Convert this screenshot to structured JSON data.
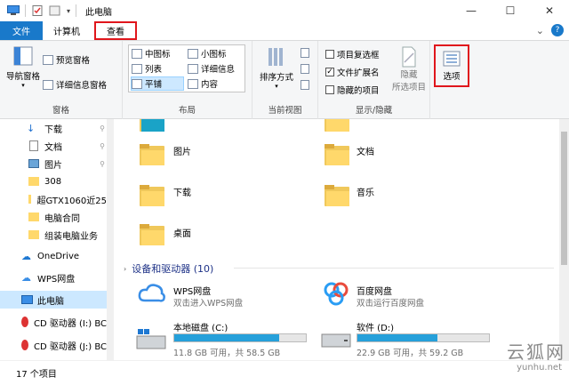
{
  "window": {
    "title": "此电脑",
    "controls": {
      "minimize": "—",
      "maximize": "☐",
      "close": "✕"
    }
  },
  "tabs": [
    {
      "label": "文件"
    },
    {
      "label": "计算机"
    },
    {
      "label": "查看"
    }
  ],
  "tabbar_icons": {
    "chevron": "⌄",
    "help": "?"
  },
  "ribbon": {
    "panes": {
      "label": "窗格",
      "nav_pane": "导航窗格",
      "preview_pane": "预览窗格",
      "details_pane": "详细信息窗格"
    },
    "layout": {
      "label": "布局",
      "items": [
        "中图标",
        "小图标",
        "列表",
        "详细信息",
        "平铺",
        "内容"
      ],
      "selected": "平铺"
    },
    "current_view": {
      "label": "当前视图",
      "sort_by": "排序方式"
    },
    "show_hide": {
      "label": "显示/隐藏",
      "item_checkboxes": "项目复选框",
      "file_extensions": "文件扩展名",
      "hidden_items": "隐藏的项目",
      "hide_selected_1": "隐藏",
      "hide_selected_2": "所选项目",
      "checked": {
        "item_checkboxes": false,
        "file_extensions": true,
        "hidden_items": false
      }
    },
    "options": {
      "label": "选项"
    }
  },
  "nav": {
    "items": [
      {
        "label": "下载",
        "pinned": true
      },
      {
        "label": "文档",
        "pinned": true
      },
      {
        "label": "图片",
        "pinned": true
      },
      {
        "label": "308"
      },
      {
        "label": "超GTX1060近25"
      },
      {
        "label": "电脑合同"
      },
      {
        "label": "组装电脑业务"
      },
      {
        "label": "OneDrive"
      },
      {
        "label": "WPS网盘"
      },
      {
        "label": "此电脑"
      },
      {
        "label": "CD 驱动器 (I:) BC"
      },
      {
        "label": "CD 驱动器 (J:) BC"
      }
    ]
  },
  "content": {
    "folders": [
      {
        "name": "图片"
      },
      {
        "name": "文档"
      },
      {
        "name": "下载"
      },
      {
        "name": "音乐"
      },
      {
        "name": "桌面"
      }
    ],
    "section": {
      "title": "设备和驱动器 (10)"
    },
    "devices": [
      {
        "name": "WPS网盘",
        "sub": "双击进入WPS网盘"
      },
      {
        "name": "百度网盘",
        "sub": "双击运行百度网盘"
      }
    ],
    "drives": [
      {
        "name": "本地磁盘 (C:)",
        "free": "11.8 GB 可用，共 58.5 GB",
        "used_fraction": 0.8
      },
      {
        "name": "软件 (D:)",
        "free": "22.9 GB 可用，共 59.2 GB",
        "used_fraction": 0.61
      }
    ]
  },
  "status": {
    "count": "17 个项目"
  },
  "watermark": {
    "brand": "云狐网",
    "url": "yunhu.net"
  }
}
